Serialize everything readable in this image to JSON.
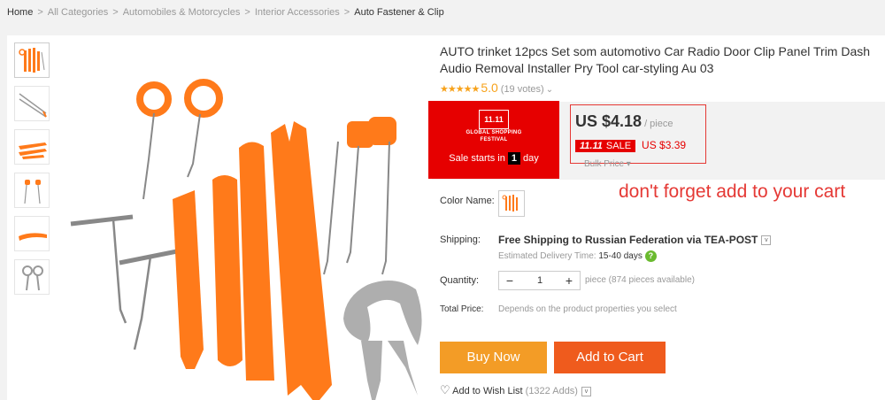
{
  "breadcrumb": [
    "Home",
    "All Categories",
    "Automobiles & Motorcycles",
    "Interior Accessories",
    "Auto Fastener & Clip"
  ],
  "breadcrumb_separator": ">",
  "product": {
    "title": "AUTO trinket 12pcs Set som automotivo Car Radio Door Clip Panel Trim Dash Audio Removal Installer Pry Tool car-styling Au 03",
    "rating_stars": "★★★★★",
    "rating_score": "5.0",
    "rating_votes": "(19 votes)",
    "rating_chevron": "⌄"
  },
  "promo": {
    "logo_text": "11.11",
    "line1": "GLOBAL SHOPPING",
    "line2": "FESTIVAL",
    "starts_label": "Sale starts in",
    "days": "1",
    "day_label": "day"
  },
  "price": {
    "amount": "US $4.18",
    "unit": "/ piece",
    "sale_event": "11.11",
    "sale_label": "SALE",
    "sale_amount": "US $3.39",
    "bulk": "Bulk Price ▾"
  },
  "overlay_text": "don't forget add to your cart",
  "color": {
    "label": "Color Name:"
  },
  "shipping": {
    "label": "Shipping:",
    "value": "Free Shipping to Russian Federation via TEA-POST",
    "dropdown": "v",
    "delivery_label": "Estimated Delivery Time:",
    "delivery_days": "15-40 days",
    "help": "?"
  },
  "quantity": {
    "label": "Quantity:",
    "minus": "−",
    "value": "1",
    "plus": "+",
    "info": "piece (874 pieces available)"
  },
  "total": {
    "label": "Total Price:",
    "value": "Depends on the product properties you select"
  },
  "buttons": {
    "buy_now": "Buy Now",
    "add_to_cart": "Add to Cart"
  },
  "wishlist": {
    "heart": "♡",
    "label": "Add to Wish List",
    "adds": "(1322 Adds)",
    "dropdown": "v"
  },
  "colors": {
    "accent_orange": "#f39c26",
    "cart_orange": "#ef5b1d",
    "sale_red": "#e60000",
    "tool_orange": "#ff7a1a",
    "star_color": "#f7a21b"
  }
}
